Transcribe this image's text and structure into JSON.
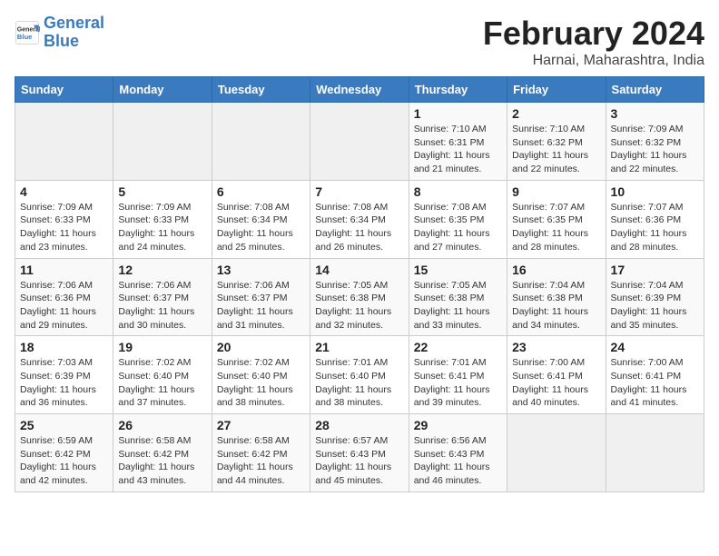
{
  "header": {
    "logo_line1": "General",
    "logo_line2": "Blue",
    "month_title": "February 2024",
    "subtitle": "Harnai, Maharashtra, India"
  },
  "weekdays": [
    "Sunday",
    "Monday",
    "Tuesday",
    "Wednesday",
    "Thursday",
    "Friday",
    "Saturday"
  ],
  "weeks": [
    [
      {
        "day": "",
        "info": ""
      },
      {
        "day": "",
        "info": ""
      },
      {
        "day": "",
        "info": ""
      },
      {
        "day": "",
        "info": ""
      },
      {
        "day": "1",
        "info": "Sunrise: 7:10 AM\nSunset: 6:31 PM\nDaylight: 11 hours and 21 minutes."
      },
      {
        "day": "2",
        "info": "Sunrise: 7:10 AM\nSunset: 6:32 PM\nDaylight: 11 hours and 22 minutes."
      },
      {
        "day": "3",
        "info": "Sunrise: 7:09 AM\nSunset: 6:32 PM\nDaylight: 11 hours and 22 minutes."
      }
    ],
    [
      {
        "day": "4",
        "info": "Sunrise: 7:09 AM\nSunset: 6:33 PM\nDaylight: 11 hours and 23 minutes."
      },
      {
        "day": "5",
        "info": "Sunrise: 7:09 AM\nSunset: 6:33 PM\nDaylight: 11 hours and 24 minutes."
      },
      {
        "day": "6",
        "info": "Sunrise: 7:08 AM\nSunset: 6:34 PM\nDaylight: 11 hours and 25 minutes."
      },
      {
        "day": "7",
        "info": "Sunrise: 7:08 AM\nSunset: 6:34 PM\nDaylight: 11 hours and 26 minutes."
      },
      {
        "day": "8",
        "info": "Sunrise: 7:08 AM\nSunset: 6:35 PM\nDaylight: 11 hours and 27 minutes."
      },
      {
        "day": "9",
        "info": "Sunrise: 7:07 AM\nSunset: 6:35 PM\nDaylight: 11 hours and 28 minutes."
      },
      {
        "day": "10",
        "info": "Sunrise: 7:07 AM\nSunset: 6:36 PM\nDaylight: 11 hours and 28 minutes."
      }
    ],
    [
      {
        "day": "11",
        "info": "Sunrise: 7:06 AM\nSunset: 6:36 PM\nDaylight: 11 hours and 29 minutes."
      },
      {
        "day": "12",
        "info": "Sunrise: 7:06 AM\nSunset: 6:37 PM\nDaylight: 11 hours and 30 minutes."
      },
      {
        "day": "13",
        "info": "Sunrise: 7:06 AM\nSunset: 6:37 PM\nDaylight: 11 hours and 31 minutes."
      },
      {
        "day": "14",
        "info": "Sunrise: 7:05 AM\nSunset: 6:38 PM\nDaylight: 11 hours and 32 minutes."
      },
      {
        "day": "15",
        "info": "Sunrise: 7:05 AM\nSunset: 6:38 PM\nDaylight: 11 hours and 33 minutes."
      },
      {
        "day": "16",
        "info": "Sunrise: 7:04 AM\nSunset: 6:38 PM\nDaylight: 11 hours and 34 minutes."
      },
      {
        "day": "17",
        "info": "Sunrise: 7:04 AM\nSunset: 6:39 PM\nDaylight: 11 hours and 35 minutes."
      }
    ],
    [
      {
        "day": "18",
        "info": "Sunrise: 7:03 AM\nSunset: 6:39 PM\nDaylight: 11 hours and 36 minutes."
      },
      {
        "day": "19",
        "info": "Sunrise: 7:02 AM\nSunset: 6:40 PM\nDaylight: 11 hours and 37 minutes."
      },
      {
        "day": "20",
        "info": "Sunrise: 7:02 AM\nSunset: 6:40 PM\nDaylight: 11 hours and 38 minutes."
      },
      {
        "day": "21",
        "info": "Sunrise: 7:01 AM\nSunset: 6:40 PM\nDaylight: 11 hours and 38 minutes."
      },
      {
        "day": "22",
        "info": "Sunrise: 7:01 AM\nSunset: 6:41 PM\nDaylight: 11 hours and 39 minutes."
      },
      {
        "day": "23",
        "info": "Sunrise: 7:00 AM\nSunset: 6:41 PM\nDaylight: 11 hours and 40 minutes."
      },
      {
        "day": "24",
        "info": "Sunrise: 7:00 AM\nSunset: 6:41 PM\nDaylight: 11 hours and 41 minutes."
      }
    ],
    [
      {
        "day": "25",
        "info": "Sunrise: 6:59 AM\nSunset: 6:42 PM\nDaylight: 11 hours and 42 minutes."
      },
      {
        "day": "26",
        "info": "Sunrise: 6:58 AM\nSunset: 6:42 PM\nDaylight: 11 hours and 43 minutes."
      },
      {
        "day": "27",
        "info": "Sunrise: 6:58 AM\nSunset: 6:42 PM\nDaylight: 11 hours and 44 minutes."
      },
      {
        "day": "28",
        "info": "Sunrise: 6:57 AM\nSunset: 6:43 PM\nDaylight: 11 hours and 45 minutes."
      },
      {
        "day": "29",
        "info": "Sunrise: 6:56 AM\nSunset: 6:43 PM\nDaylight: 11 hours and 46 minutes."
      },
      {
        "day": "",
        "info": ""
      },
      {
        "day": "",
        "info": ""
      }
    ]
  ]
}
